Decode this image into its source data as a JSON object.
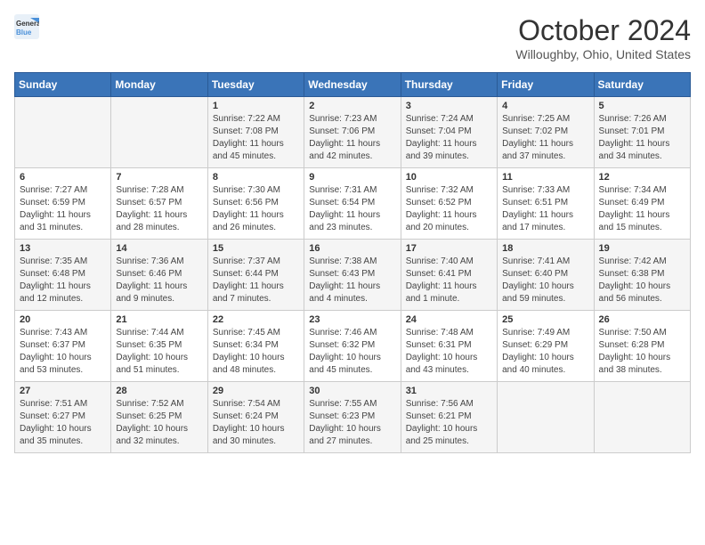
{
  "header": {
    "logo_line1": "General",
    "logo_line2": "Blue",
    "month": "October 2024",
    "location": "Willoughby, Ohio, United States"
  },
  "weekdays": [
    "Sunday",
    "Monday",
    "Tuesday",
    "Wednesday",
    "Thursday",
    "Friday",
    "Saturday"
  ],
  "weeks": [
    [
      {
        "day": "",
        "info": ""
      },
      {
        "day": "",
        "info": ""
      },
      {
        "day": "1",
        "info": "Sunrise: 7:22 AM\nSunset: 7:08 PM\nDaylight: 11 hours and 45 minutes."
      },
      {
        "day": "2",
        "info": "Sunrise: 7:23 AM\nSunset: 7:06 PM\nDaylight: 11 hours and 42 minutes."
      },
      {
        "day": "3",
        "info": "Sunrise: 7:24 AM\nSunset: 7:04 PM\nDaylight: 11 hours and 39 minutes."
      },
      {
        "day": "4",
        "info": "Sunrise: 7:25 AM\nSunset: 7:02 PM\nDaylight: 11 hours and 37 minutes."
      },
      {
        "day": "5",
        "info": "Sunrise: 7:26 AM\nSunset: 7:01 PM\nDaylight: 11 hours and 34 minutes."
      }
    ],
    [
      {
        "day": "6",
        "info": "Sunrise: 7:27 AM\nSunset: 6:59 PM\nDaylight: 11 hours and 31 minutes."
      },
      {
        "day": "7",
        "info": "Sunrise: 7:28 AM\nSunset: 6:57 PM\nDaylight: 11 hours and 28 minutes."
      },
      {
        "day": "8",
        "info": "Sunrise: 7:30 AM\nSunset: 6:56 PM\nDaylight: 11 hours and 26 minutes."
      },
      {
        "day": "9",
        "info": "Sunrise: 7:31 AM\nSunset: 6:54 PM\nDaylight: 11 hours and 23 minutes."
      },
      {
        "day": "10",
        "info": "Sunrise: 7:32 AM\nSunset: 6:52 PM\nDaylight: 11 hours and 20 minutes."
      },
      {
        "day": "11",
        "info": "Sunrise: 7:33 AM\nSunset: 6:51 PM\nDaylight: 11 hours and 17 minutes."
      },
      {
        "day": "12",
        "info": "Sunrise: 7:34 AM\nSunset: 6:49 PM\nDaylight: 11 hours and 15 minutes."
      }
    ],
    [
      {
        "day": "13",
        "info": "Sunrise: 7:35 AM\nSunset: 6:48 PM\nDaylight: 11 hours and 12 minutes."
      },
      {
        "day": "14",
        "info": "Sunrise: 7:36 AM\nSunset: 6:46 PM\nDaylight: 11 hours and 9 minutes."
      },
      {
        "day": "15",
        "info": "Sunrise: 7:37 AM\nSunset: 6:44 PM\nDaylight: 11 hours and 7 minutes."
      },
      {
        "day": "16",
        "info": "Sunrise: 7:38 AM\nSunset: 6:43 PM\nDaylight: 11 hours and 4 minutes."
      },
      {
        "day": "17",
        "info": "Sunrise: 7:40 AM\nSunset: 6:41 PM\nDaylight: 11 hours and 1 minute."
      },
      {
        "day": "18",
        "info": "Sunrise: 7:41 AM\nSunset: 6:40 PM\nDaylight: 10 hours and 59 minutes."
      },
      {
        "day": "19",
        "info": "Sunrise: 7:42 AM\nSunset: 6:38 PM\nDaylight: 10 hours and 56 minutes."
      }
    ],
    [
      {
        "day": "20",
        "info": "Sunrise: 7:43 AM\nSunset: 6:37 PM\nDaylight: 10 hours and 53 minutes."
      },
      {
        "day": "21",
        "info": "Sunrise: 7:44 AM\nSunset: 6:35 PM\nDaylight: 10 hours and 51 minutes."
      },
      {
        "day": "22",
        "info": "Sunrise: 7:45 AM\nSunset: 6:34 PM\nDaylight: 10 hours and 48 minutes."
      },
      {
        "day": "23",
        "info": "Sunrise: 7:46 AM\nSunset: 6:32 PM\nDaylight: 10 hours and 45 minutes."
      },
      {
        "day": "24",
        "info": "Sunrise: 7:48 AM\nSunset: 6:31 PM\nDaylight: 10 hours and 43 minutes."
      },
      {
        "day": "25",
        "info": "Sunrise: 7:49 AM\nSunset: 6:29 PM\nDaylight: 10 hours and 40 minutes."
      },
      {
        "day": "26",
        "info": "Sunrise: 7:50 AM\nSunset: 6:28 PM\nDaylight: 10 hours and 38 minutes."
      }
    ],
    [
      {
        "day": "27",
        "info": "Sunrise: 7:51 AM\nSunset: 6:27 PM\nDaylight: 10 hours and 35 minutes."
      },
      {
        "day": "28",
        "info": "Sunrise: 7:52 AM\nSunset: 6:25 PM\nDaylight: 10 hours and 32 minutes."
      },
      {
        "day": "29",
        "info": "Sunrise: 7:54 AM\nSunset: 6:24 PM\nDaylight: 10 hours and 30 minutes."
      },
      {
        "day": "30",
        "info": "Sunrise: 7:55 AM\nSunset: 6:23 PM\nDaylight: 10 hours and 27 minutes."
      },
      {
        "day": "31",
        "info": "Sunrise: 7:56 AM\nSunset: 6:21 PM\nDaylight: 10 hours and 25 minutes."
      },
      {
        "day": "",
        "info": ""
      },
      {
        "day": "",
        "info": ""
      }
    ]
  ]
}
